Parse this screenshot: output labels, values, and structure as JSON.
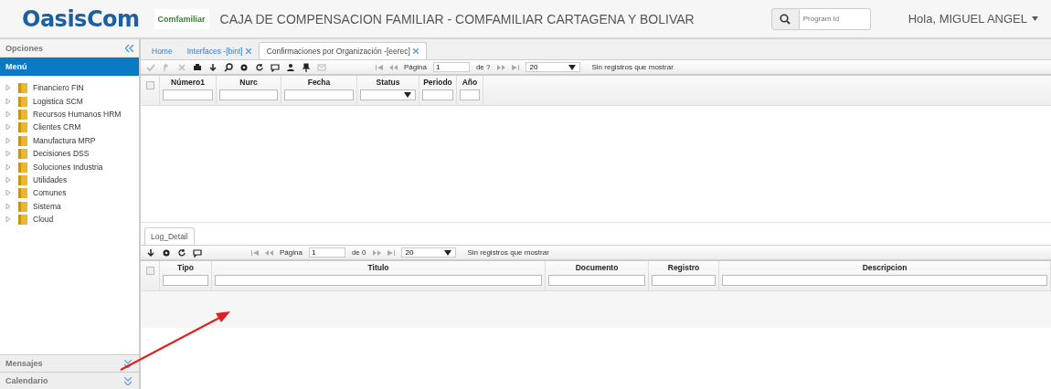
{
  "header": {
    "brand": "OasisCom",
    "partner_logo": "Comfamiliar",
    "title": "CAJA DE COMPENSACION FAMILIAR - COMFAMILIAR CARTAGENA Y BOLIVAR",
    "search": {
      "placeholder": "Program Id"
    },
    "user": "Hola, MIGUEL ANGEL"
  },
  "sidebar": {
    "title": "Opciones",
    "menu_label": "Menú",
    "items": [
      {
        "label": "Financiero FIN",
        "expanded": false
      },
      {
        "label": "Logistica SCM",
        "expanded": false
      },
      {
        "label": "Recursos Humanos HRM",
        "expanded": false
      },
      {
        "label": "Clientes CRM",
        "expanded": false
      },
      {
        "label": "Manufactura MRP",
        "expanded": false
      },
      {
        "label": "Decisiones DSS",
        "expanded": false
      },
      {
        "label": "Soluciones Industria",
        "expanded": false
      },
      {
        "label": "Utilidades",
        "expanded": false
      },
      {
        "label": "Comunes",
        "expanded": false
      },
      {
        "label": "Sistema",
        "expanded": false
      },
      {
        "label": "Cloud",
        "expanded": false
      }
    ],
    "panels": [
      {
        "label": "Mensajes"
      },
      {
        "label": "Calendario"
      }
    ]
  },
  "tabs": [
    {
      "label": "Home",
      "closable": false,
      "selected": false
    },
    {
      "label": "Interfaces -[bint]",
      "closable": true,
      "selected": false
    },
    {
      "label": "Confirmaciones por Organización -[eerec]",
      "closable": true,
      "selected": true
    }
  ],
  "upper_grid": {
    "tools": [
      {
        "kind": "check",
        "disabled": true
      },
      {
        "kind": "undo",
        "disabled": true
      },
      {
        "kind": "cancel",
        "disabled": true
      },
      {
        "kind": "print",
        "disabled": false
      },
      {
        "kind": "download",
        "disabled": false
      },
      {
        "kind": "search",
        "disabled": false
      },
      {
        "kind": "gear",
        "disabled": false
      },
      {
        "kind": "refresh",
        "disabled": false
      },
      {
        "kind": "comment",
        "disabled": false
      },
      {
        "kind": "person",
        "disabled": false
      },
      {
        "kind": "pin",
        "disabled": false
      },
      {
        "kind": "mail",
        "disabled": true
      }
    ],
    "pager": {
      "page_label": "Página",
      "page": "1",
      "of": "de ?",
      "page_size": "20",
      "status": "Sin registros que mostrar"
    },
    "all_selected": false,
    "columns": [
      {
        "label": "Número1",
        "kind": "text"
      },
      {
        "label": "Nurc",
        "kind": "text"
      },
      {
        "label": "Fecha",
        "kind": "text"
      },
      {
        "label": "Status",
        "kind": "select"
      },
      {
        "label": "Periodo",
        "kind": "text"
      },
      {
        "label": "Año",
        "kind": "text"
      }
    ]
  },
  "detail_tabs": [
    {
      "label": "Log_Detail",
      "selected": true
    }
  ],
  "lower_grid": {
    "tools": [
      {
        "kind": "download",
        "disabled": false
      },
      {
        "kind": "gear",
        "disabled": false
      },
      {
        "kind": "refresh",
        "disabled": false
      },
      {
        "kind": "comment",
        "disabled": false
      }
    ],
    "pager": {
      "page_label": "Página",
      "page": "1",
      "of": "de 0",
      "page_size": "20",
      "status": "Sin registros que mostrar"
    },
    "all_selected": false,
    "columns": [
      {
        "label": "Tipo",
        "kind": "text"
      },
      {
        "label": "Titulo",
        "kind": "text"
      },
      {
        "label": "Documento",
        "kind": "text"
      },
      {
        "label": "Registro",
        "kind": "text"
      },
      {
        "label": "Descripcion",
        "kind": "text"
      }
    ]
  }
}
